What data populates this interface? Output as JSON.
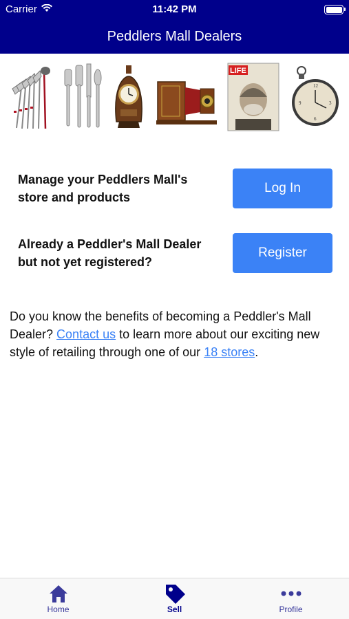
{
  "status_bar": {
    "carrier": "Carrier",
    "time": "11:42 PM"
  },
  "header": {
    "title": "Peddlers Mall Dealers"
  },
  "banner": {
    "images": [
      "golf-clubs",
      "silverware",
      "mantel-clock",
      "antique-camera",
      "life-magazine",
      "pocket-watch"
    ]
  },
  "actions": [
    {
      "text": "Manage your Peddlers Mall's store and products",
      "button": "Log In"
    },
    {
      "text": "Already a Peddler's Mall Dealer but not yet registered?",
      "button": "Register"
    }
  ],
  "info": {
    "text_before": "Do you know the benefits of becoming a Peddler's Mall Dealer? ",
    "link1": "Contact us",
    "text_middle": " to learn more about our exciting new style of retailing through one of our ",
    "link2": "18 stores",
    "text_after": "."
  },
  "magazine": {
    "title": "LIFE"
  },
  "tabs": [
    {
      "label": "Home",
      "icon": "home-icon"
    },
    {
      "label": "Sell",
      "icon": "tag-icon",
      "active": true
    },
    {
      "label": "Profile",
      "icon": "more-icon"
    }
  ],
  "colors": {
    "header": "#00008b",
    "accent": "#3b82f6"
  }
}
